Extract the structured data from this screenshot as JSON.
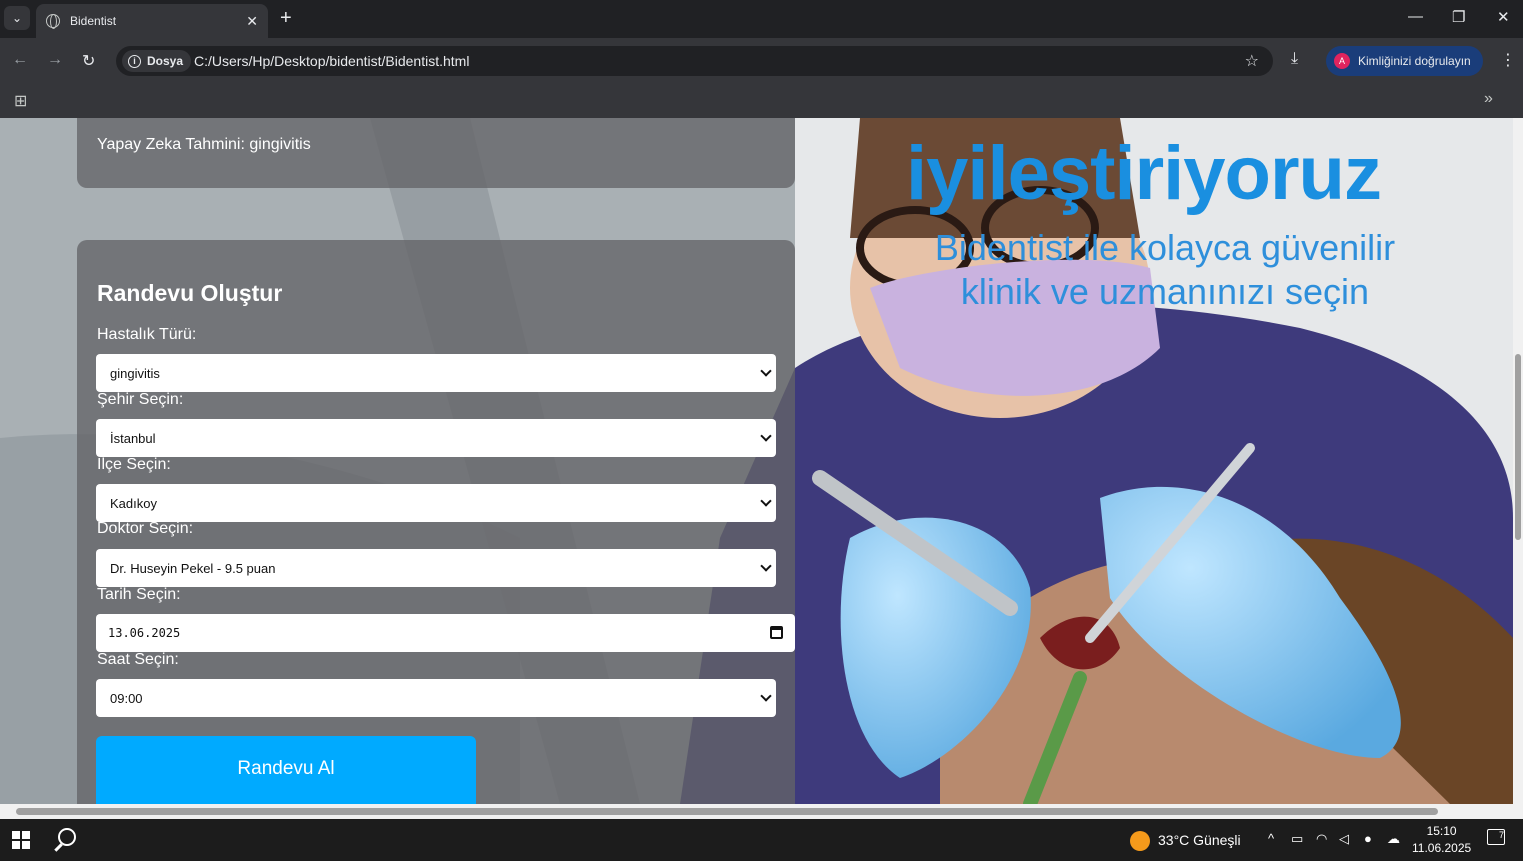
{
  "browser": {
    "tab_title": "Bidentist",
    "tab_close": "✕",
    "new_tab": "+",
    "site_chip": "Dosya",
    "url": "C:/Users/Hp/Desktop/bidentist/Bidentist.html",
    "profile_label": "Kimliğinizi doğrulayın",
    "profile_initial": "A"
  },
  "page": {
    "ai_prediction": "Yapay Zeka Tahmini: gingivitis",
    "hero_title": "iyileştiriyoruz",
    "hero_subtitle": "Bidentist ile kolayca güvenilir klinik ve uzmanınızı seçin",
    "form": {
      "title": "Randevu Oluştur",
      "disease_label": "Hastalık Türü:",
      "disease_value": "gingivitis",
      "city_label": "Şehir Seçin:",
      "city_value": "İstanbul",
      "district_label": "İlçe Seçin:",
      "district_value": "Kadıkoy",
      "doctor_label": "Doktor Seçin:",
      "doctor_value": "Dr. Huseyin Pekel - 9.5 puan",
      "date_label": "Tarih Seçin:",
      "date_value": "13.06.2025",
      "time_label": "Saat Seçin:",
      "time_value": "09:00",
      "submit_label": "Randevu Al"
    }
  },
  "taskbar": {
    "weather": "33°C Güneşli",
    "time": "15:10",
    "date": "11.06.2025",
    "notification_count": "7"
  },
  "colors": {
    "accent_button": "#00aaff",
    "hero_text": "#1a8fe0"
  }
}
